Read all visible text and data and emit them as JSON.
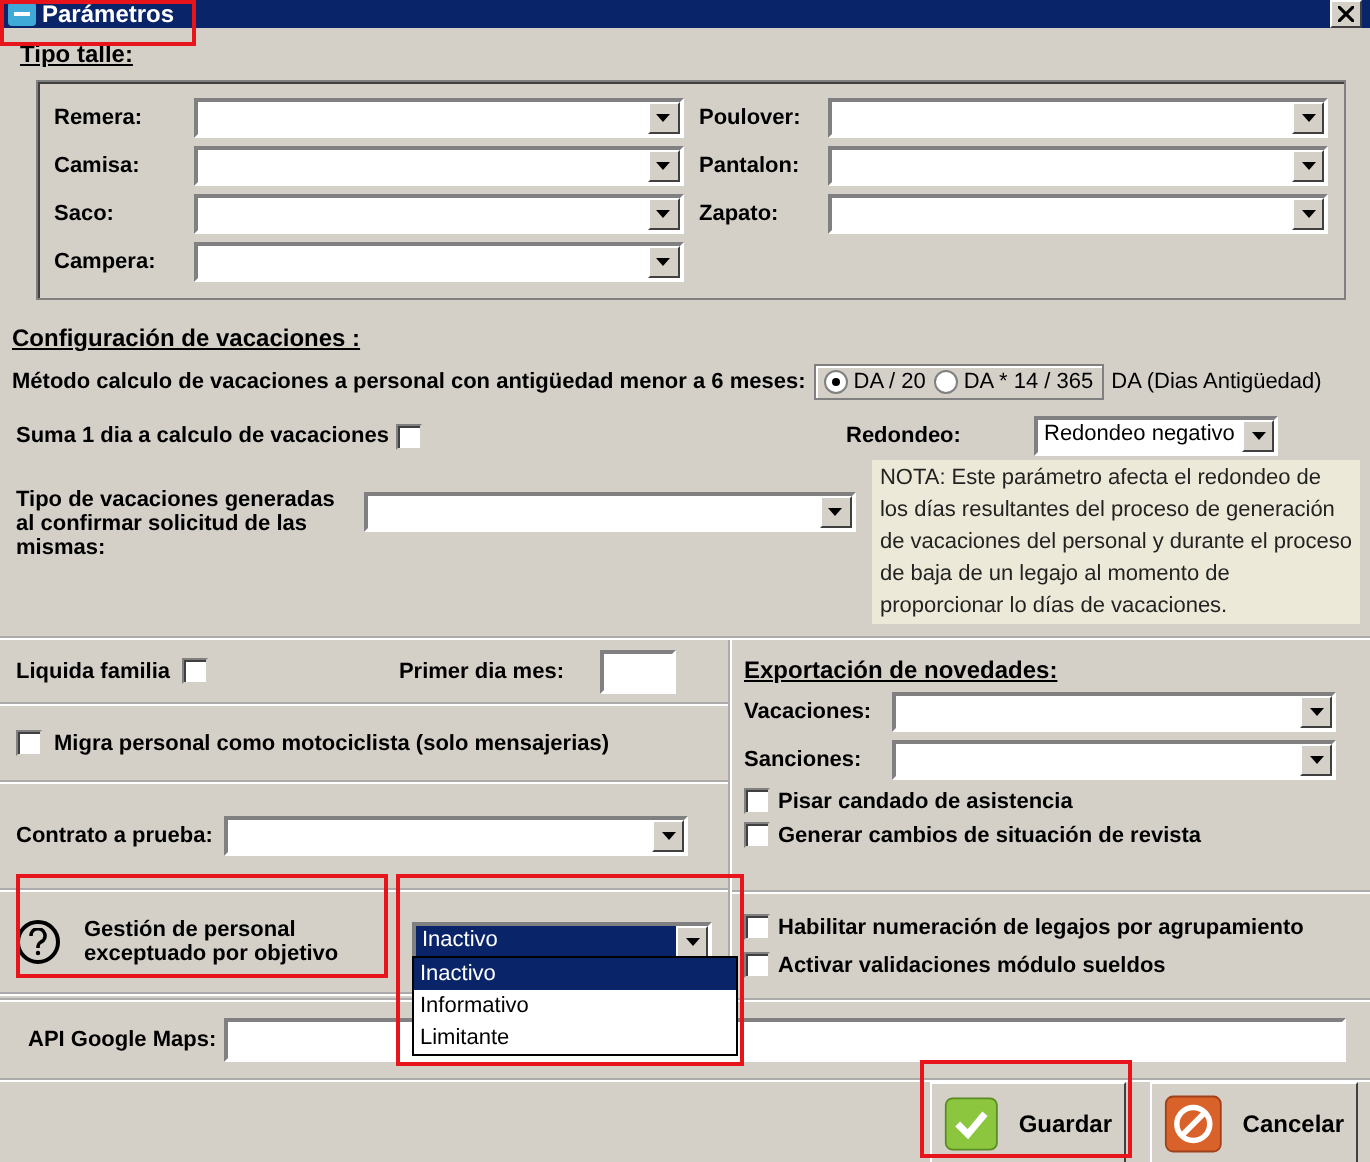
{
  "window": {
    "title": "Parámetros"
  },
  "tipo_talle": {
    "heading": "Tipo talle:",
    "left_fields": [
      {
        "label": "Remera:"
      },
      {
        "label": "Camisa:"
      },
      {
        "label": "Saco:"
      },
      {
        "label": "Campera:"
      }
    ],
    "right_fields": [
      {
        "label": "Poulover:"
      },
      {
        "label": "Pantalon:"
      },
      {
        "label": "Zapato:"
      }
    ]
  },
  "vacaciones": {
    "heading": "Configuración de vacaciones :",
    "metodo": {
      "label": "Método calculo de vacaciones a personal con antigüedad menor a 6 meses:",
      "options": [
        {
          "label": "DA / 20",
          "selected": true
        },
        {
          "label": "DA * 14 / 365",
          "selected": false
        }
      ],
      "suffix": "DA (Dias Antigüedad)"
    },
    "suma": {
      "label": "Suma 1 dia a calculo de vacaciones",
      "checked": false
    },
    "redondeo": {
      "label": "Redondeo:",
      "value": "Redondeo negativo"
    },
    "tipo_generadas": {
      "label": "Tipo de vacaciones generadas al confirmar solicitud de las mismas:"
    },
    "nota": "NOTA: Este parámetro afecta el redondeo de los días resultantes del proceso de generación de vacaciones del personal y durante el proceso de baja de un legajo al momento de proporcionar lo días de vacaciones."
  },
  "liquida_familia": {
    "label": "Liquida familia",
    "checked": false
  },
  "primer_dia_mes": {
    "label": "Primer dia mes:"
  },
  "migra": {
    "label": "Migra personal como motociclista (solo mensajerias)",
    "checked": false
  },
  "contrato": {
    "label": "Contrato a prueba:"
  },
  "gestion": {
    "label": "Gestión de personal exceptuado por objetivo",
    "value": "Inactivo",
    "expanded": true,
    "options": [
      {
        "label": "Inactivo",
        "selected": true
      },
      {
        "label": "Informativo",
        "selected": false
      },
      {
        "label": "Limitante",
        "selected": false
      }
    ]
  },
  "exportacion": {
    "heading": "Exportación de novedades:",
    "fields": [
      {
        "label": "Vacaciones:"
      },
      {
        "label": "Sanciones:"
      }
    ],
    "checks": [
      {
        "label": "Pisar candado de asistencia",
        "checked": false
      },
      {
        "label": "Generar cambios de situación de revista",
        "checked": false
      }
    ]
  },
  "otros_checks": [
    {
      "label": "Habilitar numeración de legajos por agrupamiento",
      "checked": false
    },
    {
      "label": "Activar validaciones módulo sueldos",
      "checked": false
    }
  ],
  "api": {
    "label": "API Google Maps:"
  },
  "buttons": [
    {
      "label": "Guardar",
      "kind": "save"
    },
    {
      "label": "Cancelar",
      "kind": "cancel"
    }
  ]
}
